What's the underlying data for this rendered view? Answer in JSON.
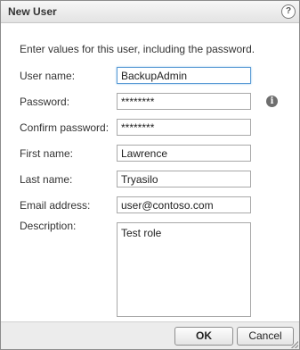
{
  "dialog": {
    "title": "New User",
    "help_icon": "question-mark-icon",
    "help_glyph": "?",
    "intro": "Enter values for this user, including the password."
  },
  "fields": {
    "username": {
      "label": "User name:",
      "value": "BackupAdmin"
    },
    "password": {
      "label": "Password:",
      "value": "********"
    },
    "confirm": {
      "label": "Confirm password:",
      "value": "********"
    },
    "first": {
      "label": "First name:",
      "value": "Lawrence"
    },
    "last": {
      "label": "Last name:",
      "value": "Tryasilo"
    },
    "email": {
      "label": "Email address:",
      "value": "user@contoso.com"
    },
    "description": {
      "label": "Description:",
      "value": "Test role"
    }
  },
  "info_icon": {
    "name": "info-icon",
    "glyph": "i"
  },
  "buttons": {
    "ok": "OK",
    "cancel": "Cancel"
  },
  "colors": {
    "focus_border": "#5b9bd5",
    "title_bg": "#e3e3e3",
    "footer_bg": "#ececec"
  }
}
